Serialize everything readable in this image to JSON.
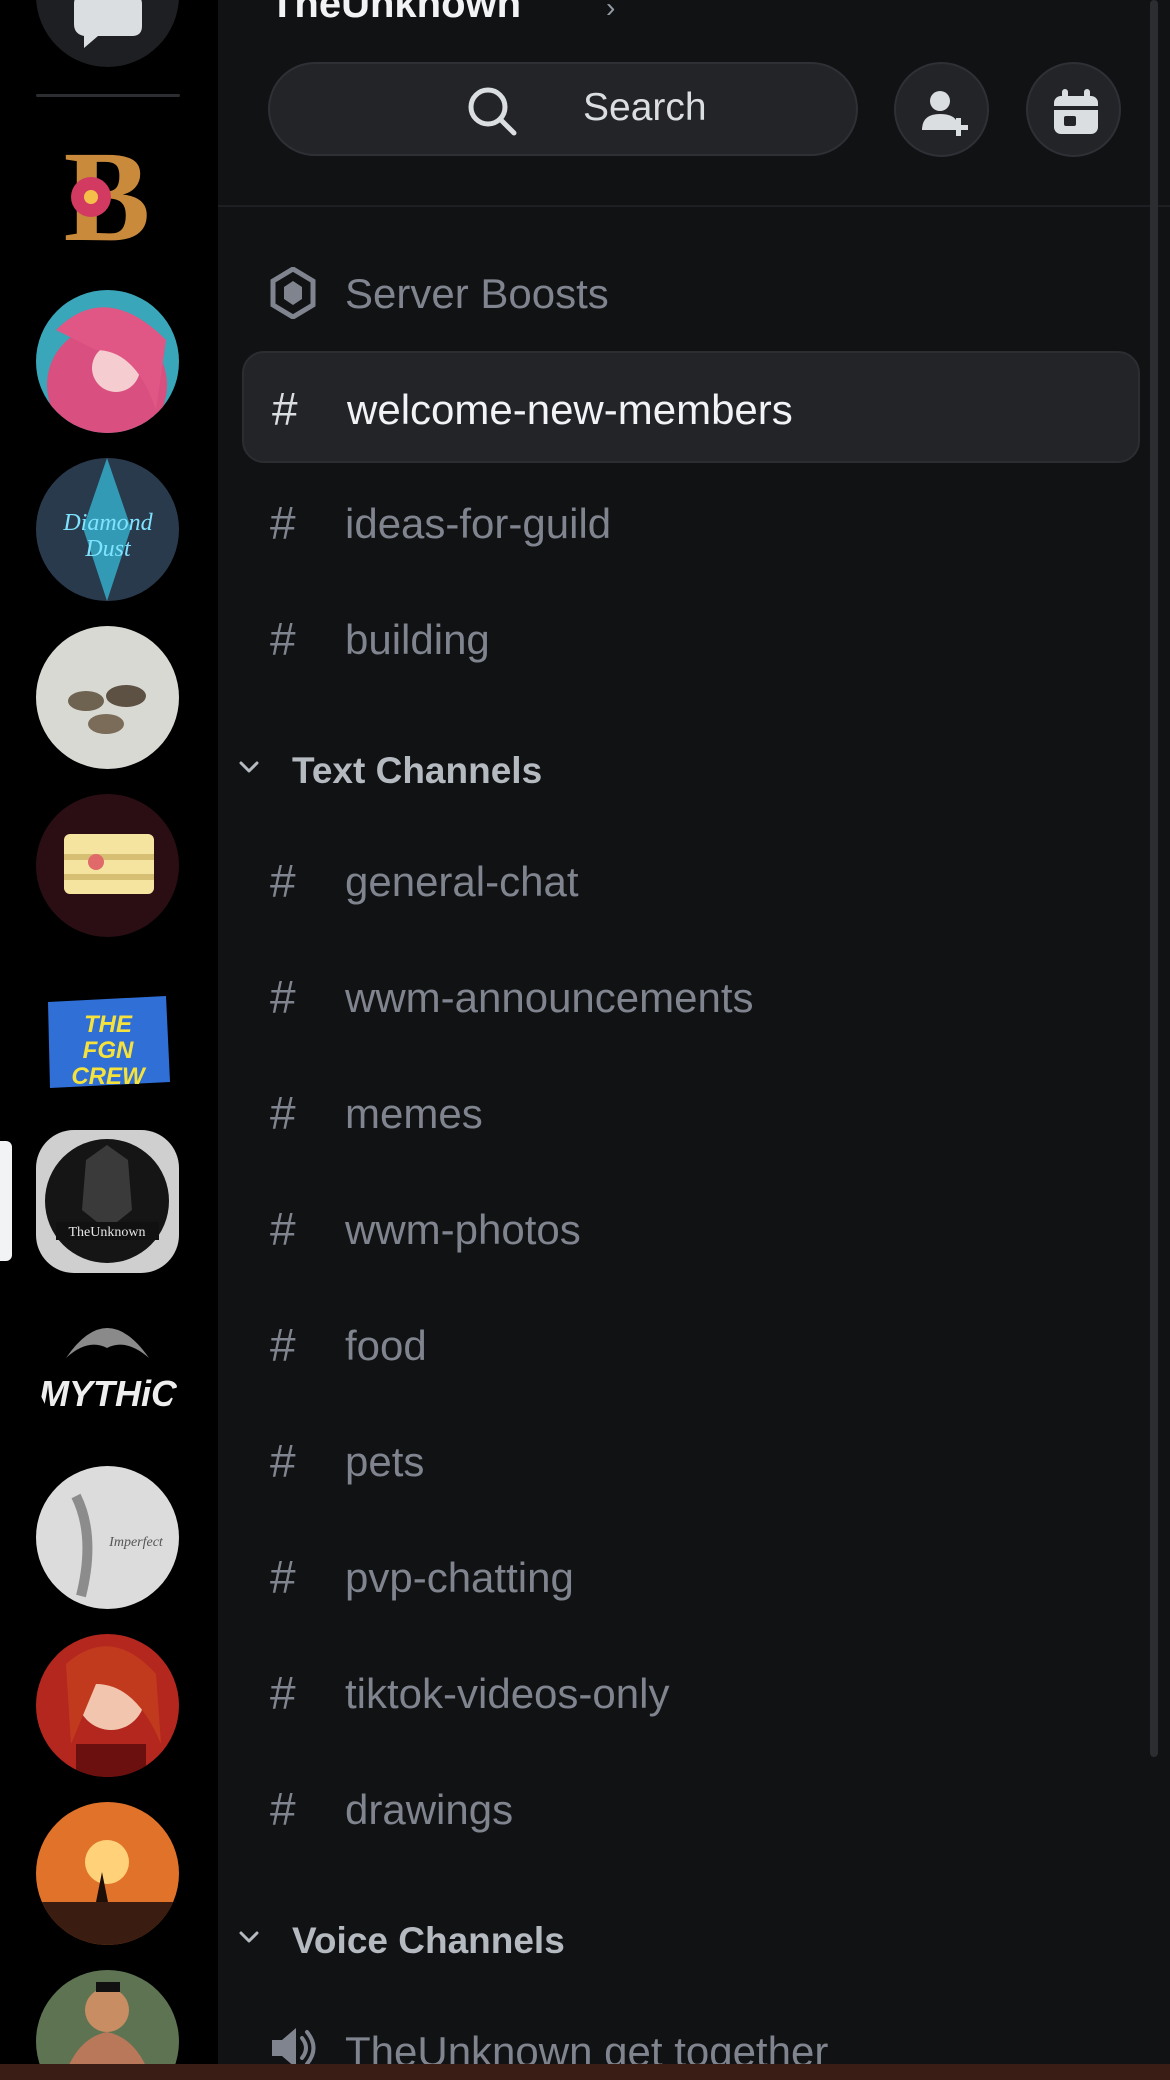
{
  "server": {
    "title": "TheUnknown"
  },
  "header": {
    "search_label": "Search"
  },
  "channels_top": [
    {
      "type": "boost",
      "name": "Server Boosts",
      "selected": false
    },
    {
      "type": "text",
      "name": "welcome-new-members",
      "selected": true
    },
    {
      "type": "text",
      "name": "ideas-for-guild",
      "selected": false
    },
    {
      "type": "text",
      "name": "building",
      "selected": false
    }
  ],
  "text_category": {
    "label": "Text Channels",
    "channels": [
      "general-chat",
      "wwm-announcements",
      "memes",
      "wwm-photos",
      "food",
      "pets",
      "pvp-chatting",
      "tiktok-videos-only",
      "drawings"
    ]
  },
  "voice_category": {
    "label": "Voice Channels",
    "channels": [
      "TheUnknown get together"
    ]
  },
  "rail": {
    "servers": [
      {
        "name": "B flower emblem",
        "bg": "#2a1a10"
      },
      {
        "name": "Pink-haired anime girl",
        "bg": "#c94a7a"
      },
      {
        "name": "Diamond Dust",
        "bg": "#243447"
      },
      {
        "name": "Wolves in snow",
        "bg": "#c9c9c4"
      },
      {
        "name": "Stacked boxes",
        "bg": "#2c1016"
      },
      {
        "name": "The FGN Crew",
        "bg": "#1b1b1b"
      },
      {
        "name": "TheUnknown",
        "bg": "#cfcfcf",
        "selected": true
      },
      {
        "name": "Mythic dragon",
        "bg": "#0b0b0b"
      },
      {
        "name": "Imperfect sketch",
        "bg": "#d8d8d8"
      },
      {
        "name": "Red-haired girl",
        "bg": "#b3271e"
      },
      {
        "name": "Sunset silhouette",
        "bg": "#e0722a"
      },
      {
        "name": "Muscle man",
        "bg": "#6a7f5e"
      }
    ]
  },
  "colors": {
    "panel_bg": "#111214",
    "rail_bg": "#000000",
    "muted": "#80848e",
    "selected_row": "#232428"
  }
}
